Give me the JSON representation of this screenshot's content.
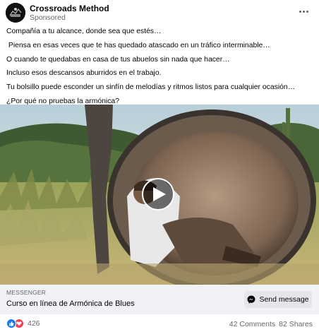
{
  "header": {
    "page_name": "Crossroads Method",
    "sponsored_label": "Sponsored",
    "avatar_icon": "crossroads-logo",
    "more_icon": "more-options-icon"
  },
  "post": {
    "lines": [
      "Compañía a tu alcance, donde sea que estés…",
      " Piensa en esas veces que te has quedado atascado en un tráfico interminable…",
      "O cuando te quedabas en casa de tus abuelos sin nada que hacer…",
      "Incluso esos descansos aburridos en el trabajo.",
      "Tu bolsillo puede esconder un sinfín de melodías y ritmos listos para cualquier ocasión…",
      "¿Por qué no pruebas la armónica?"
    ]
  },
  "media": {
    "type": "video",
    "play_icon": "play-icon"
  },
  "cta": {
    "source": "MESSENGER",
    "title": "Curso en línea de Armónica de Blues",
    "button_label": "Send message",
    "button_icon": "messenger-icon"
  },
  "footer": {
    "reaction_count": "426",
    "reaction_icons": [
      "like-icon",
      "love-icon"
    ],
    "comments": "42 Comments",
    "shares": "82 Shares"
  },
  "colors": {
    "accent": "#1877f2",
    "love": "#f33e58",
    "secondary_text": "#65676b",
    "cta_background": "#f0f2f5"
  }
}
